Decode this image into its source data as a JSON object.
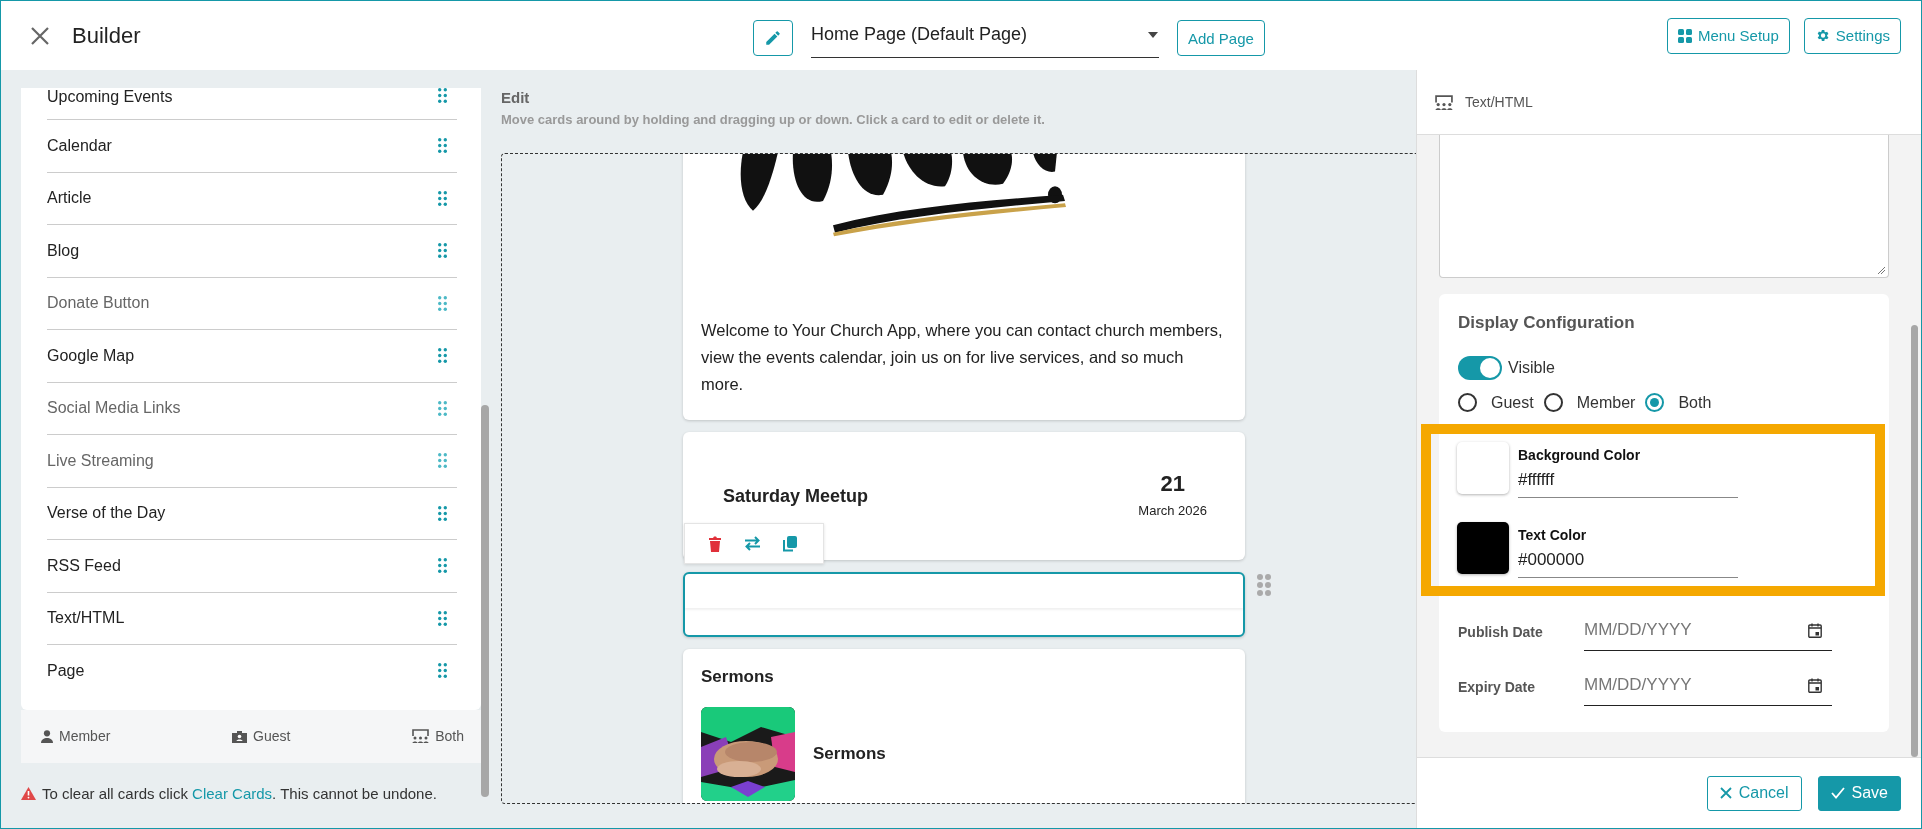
{
  "header": {
    "title": "Builder",
    "page_select": {
      "value": "Home Page (Default Page)"
    },
    "buttons": [
      {
        "kind": "add",
        "label": "Add Page"
      },
      {
        "kind": "menu",
        "label": "Menu Setup"
      },
      {
        "kind": "settings",
        "label": "Settings"
      }
    ]
  },
  "sidebar": {
    "items": [
      {
        "label": "Upcoming Events",
        "dimmed": false
      },
      {
        "label": "Calendar",
        "dimmed": false
      },
      {
        "label": "Article",
        "dimmed": false
      },
      {
        "label": "Blog",
        "dimmed": false
      },
      {
        "label": "Donate Button",
        "dimmed": true
      },
      {
        "label": "Google Map",
        "dimmed": false
      },
      {
        "label": "Social Media Links",
        "dimmed": true
      },
      {
        "label": "Live Streaming",
        "dimmed": true
      },
      {
        "label": "Verse of the Day",
        "dimmed": false
      },
      {
        "label": "RSS Feed",
        "dimmed": false
      },
      {
        "label": "Text/HTML",
        "dimmed": false
      },
      {
        "label": "Page",
        "dimmed": false
      }
    ],
    "legend": [
      {
        "kind": "member",
        "label": "Member"
      },
      {
        "kind": "guest",
        "label": "Guest"
      },
      {
        "kind": "both",
        "label": "Both"
      }
    ],
    "warning": {
      "before": "To clear all cards click",
      "link": "Clear Cards",
      "after": ". This cannot be undone."
    }
  },
  "editor": {
    "title": "Edit",
    "hint": "Move cards around by holding and dragging up or down. Click a card to edit or delete it.",
    "cards": [
      {
        "kind": "welcome",
        "selected": false,
        "text": "Welcome to Your Church App, where you can contact church members, view the events calendar, join us on for live services, and so much more."
      },
      {
        "kind": "event",
        "selected": false,
        "title": "Saturday Meetup",
        "day": "21",
        "month": "March 2026"
      },
      {
        "kind": "empty",
        "selected": true
      },
      {
        "kind": "sermons",
        "selected": false,
        "title": "Sermons",
        "item_title": "Sermons"
      }
    ]
  },
  "properties": {
    "type_label": "Text/HTML",
    "display": {
      "title": "Display Configuration",
      "visible": {
        "label": "Visible",
        "on": true
      },
      "audience": [
        {
          "label": "Guest",
          "selected": false
        },
        {
          "label": "Member",
          "selected": false
        },
        {
          "label": "Both",
          "selected": true
        }
      ],
      "colors": [
        {
          "label": "Background Color",
          "value": "#ffffff",
          "color": "#ffffff"
        },
        {
          "label": "Text Color",
          "value": "#000000",
          "color": "#000000"
        }
      ],
      "dates": [
        {
          "label": "Publish Date",
          "placeholder": "MM/DD/YYYY"
        },
        {
          "label": "Expiry Date",
          "placeholder": "MM/DD/YYYY"
        }
      ]
    },
    "buttons": [
      {
        "kind": "cancel",
        "label": "Cancel"
      },
      {
        "kind": "save",
        "label": "Save"
      }
    ]
  }
}
